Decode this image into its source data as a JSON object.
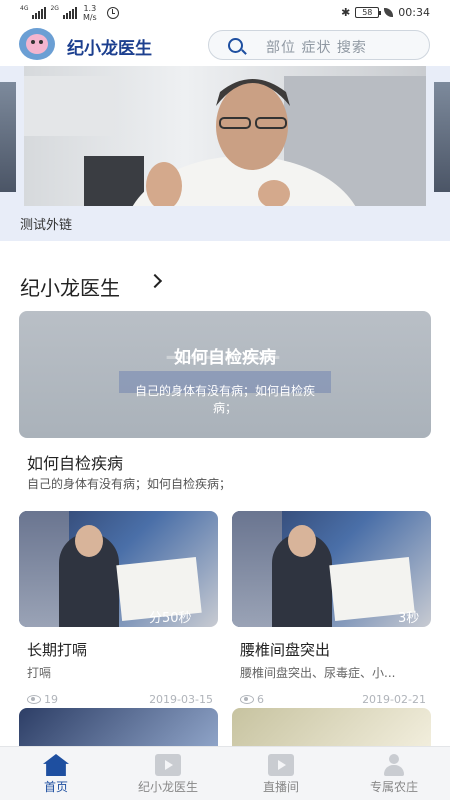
{
  "status_bar": {
    "signal_1": "4G",
    "signal_2": "2G",
    "speed_value": "1.3",
    "speed_unit": "M/s",
    "battery": "58",
    "time": "00:34"
  },
  "header": {
    "app_title": "纪小龙医生",
    "search_placeholder": "部位 症状 搜索"
  },
  "banner": {
    "caption": "测试外链"
  },
  "section": {
    "title": "纪小龙医生"
  },
  "featured": {
    "overlay_title": "如何自检疾病",
    "overlay_desc": "自己的身体有没有病；如何自检疾病；",
    "heading": "如何自检疾病",
    "subtitle": "自己的身体有没有病；如何自检疾病；"
  },
  "videos": [
    {
      "duration": "分50秒",
      "title": "长期打嗝",
      "subtitle": "打嗝",
      "views": "19",
      "date": "2019-03-15"
    },
    {
      "duration": "3秒",
      "title": "腰椎间盘突出",
      "subtitle": "腰椎间盘突出、尿毒症、小...",
      "views": "6",
      "date": "2019-02-21"
    }
  ],
  "tabs": [
    {
      "label": "首页",
      "icon": "home-icon",
      "active": true
    },
    {
      "label": "纪小龙医生",
      "icon": "film-icon",
      "active": false
    },
    {
      "label": "直播间",
      "icon": "live-icon",
      "active": false
    },
    {
      "label": "专属农庄",
      "icon": "person-icon",
      "active": false
    }
  ],
  "colors": {
    "brand": "#1c3f8f",
    "accent": "#1e4fa0",
    "muted": "#b0b4ba"
  }
}
